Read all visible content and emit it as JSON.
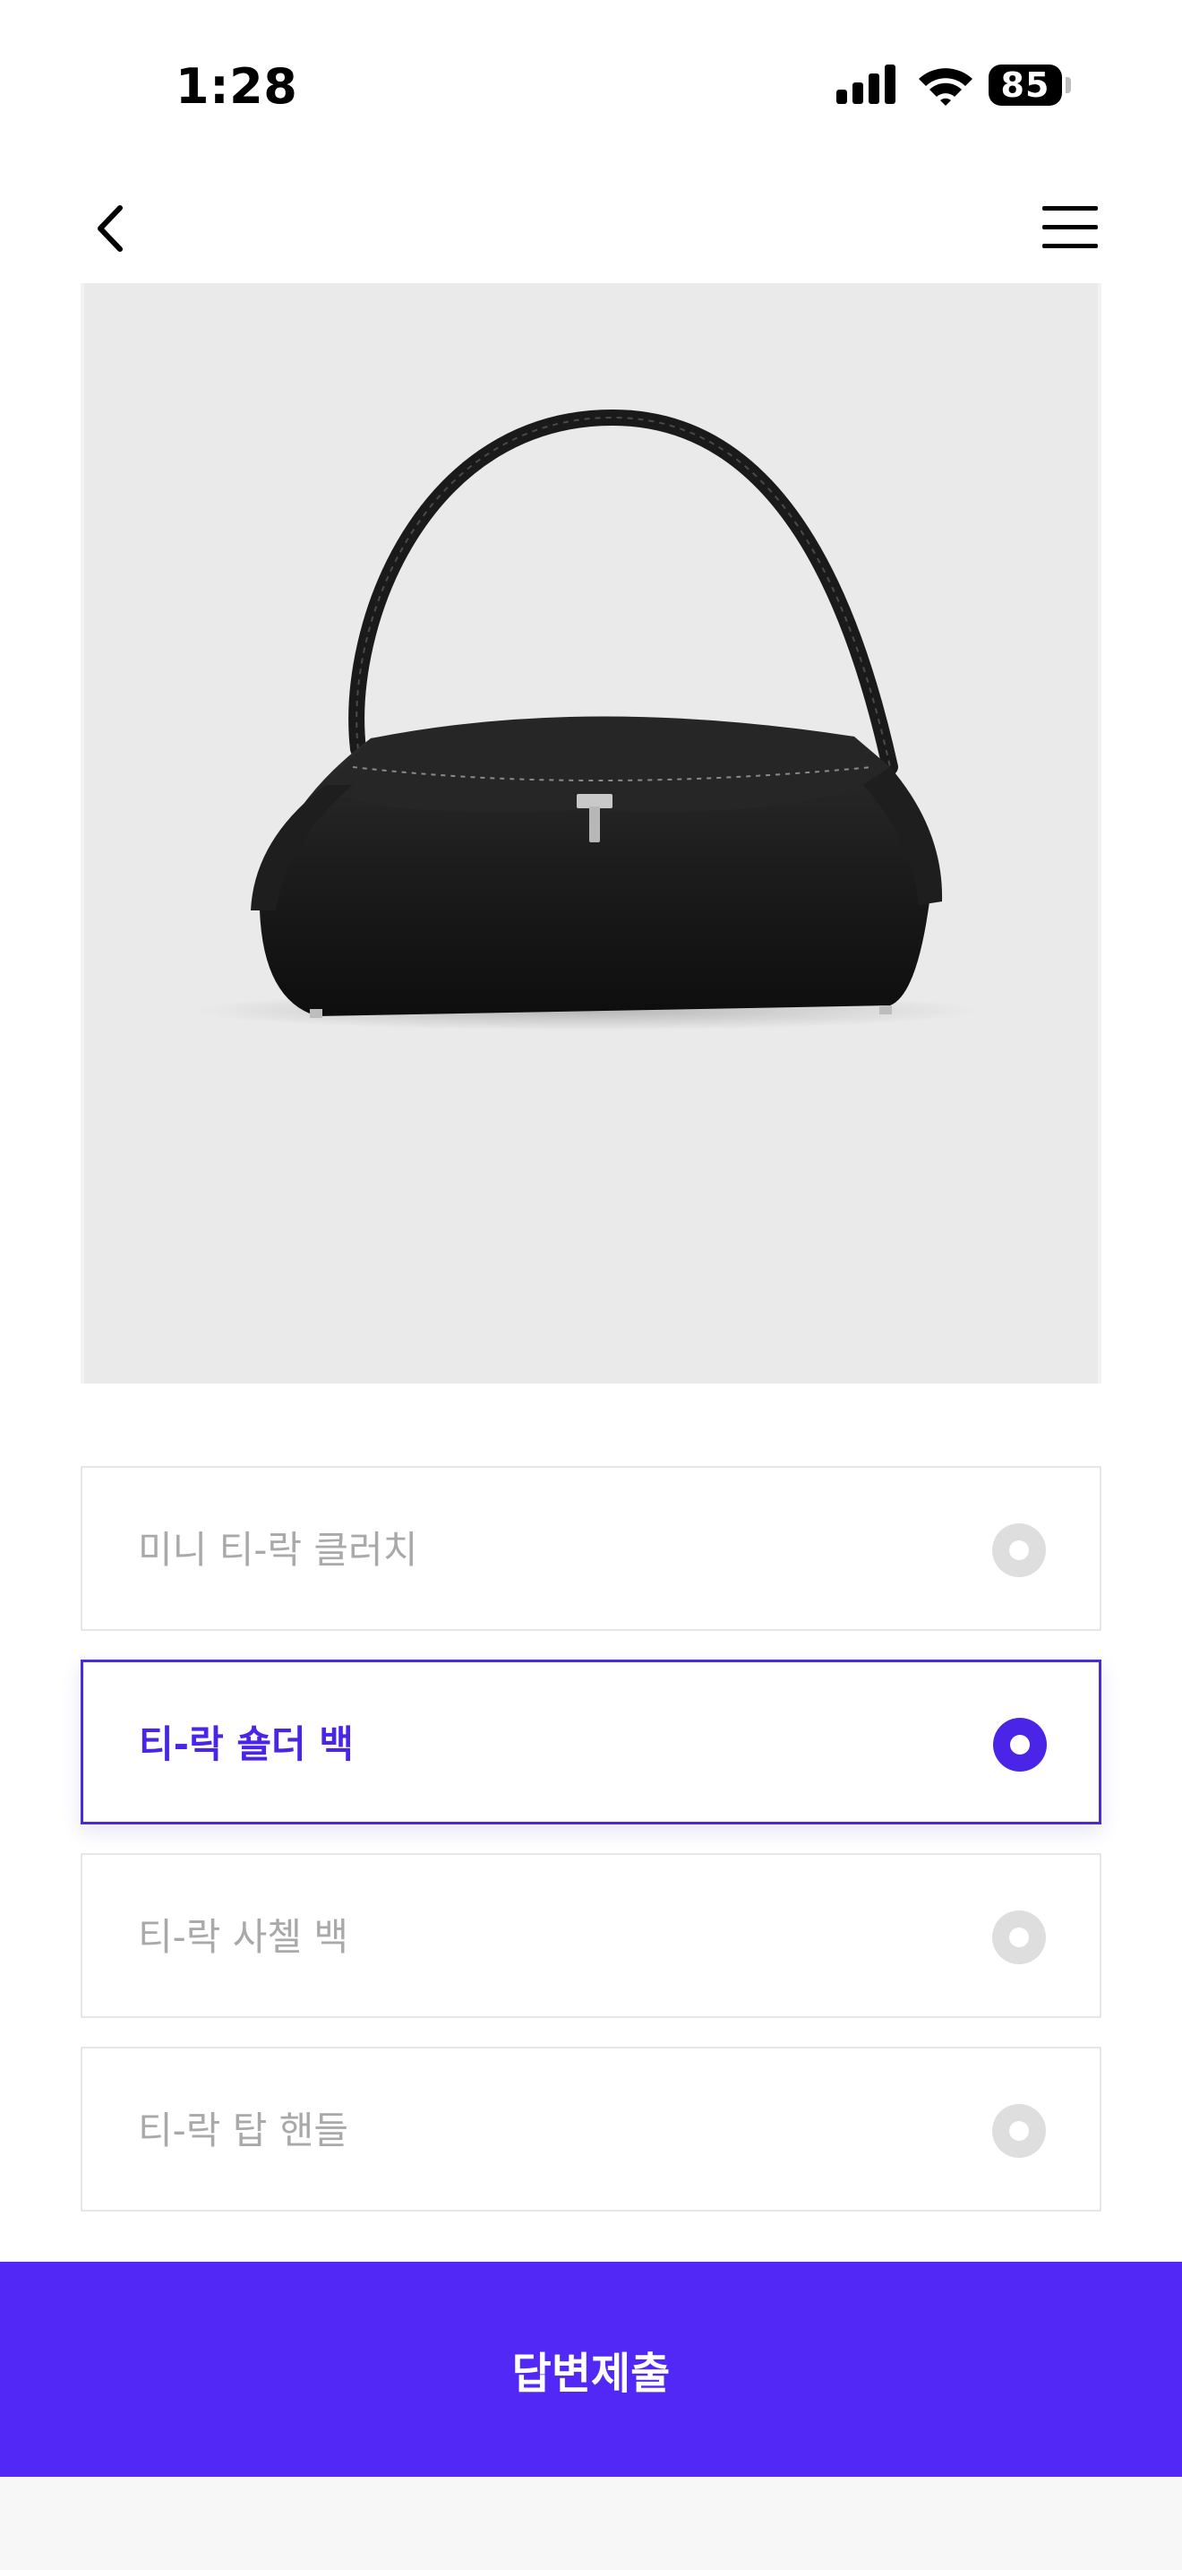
{
  "status_bar": {
    "time": "1:28",
    "battery": "85",
    "icons": [
      "signal-icon",
      "wifi-icon",
      "battery-icon"
    ]
  },
  "nav": {
    "back_icon": "chevron-left-icon",
    "menu_icon": "hamburger-menu-icon"
  },
  "product": {
    "image": "black-leather-shoulder-bag",
    "background_color": "#eaeaea"
  },
  "options": [
    {
      "label": "미니 티-락 클러치",
      "selected": false
    },
    {
      "label": "티-락 숄더 백",
      "selected": true
    },
    {
      "label": "티-락 사첼 백",
      "selected": false
    },
    {
      "label": "티-락 탑 핸들",
      "selected": false
    }
  ],
  "submit": {
    "label": "답변제출"
  },
  "colors": {
    "accent": "#5128f5",
    "selected_text": "#4a25e8",
    "unselected_text": "#a9a9a9",
    "radio_unselected": "#dedede"
  }
}
